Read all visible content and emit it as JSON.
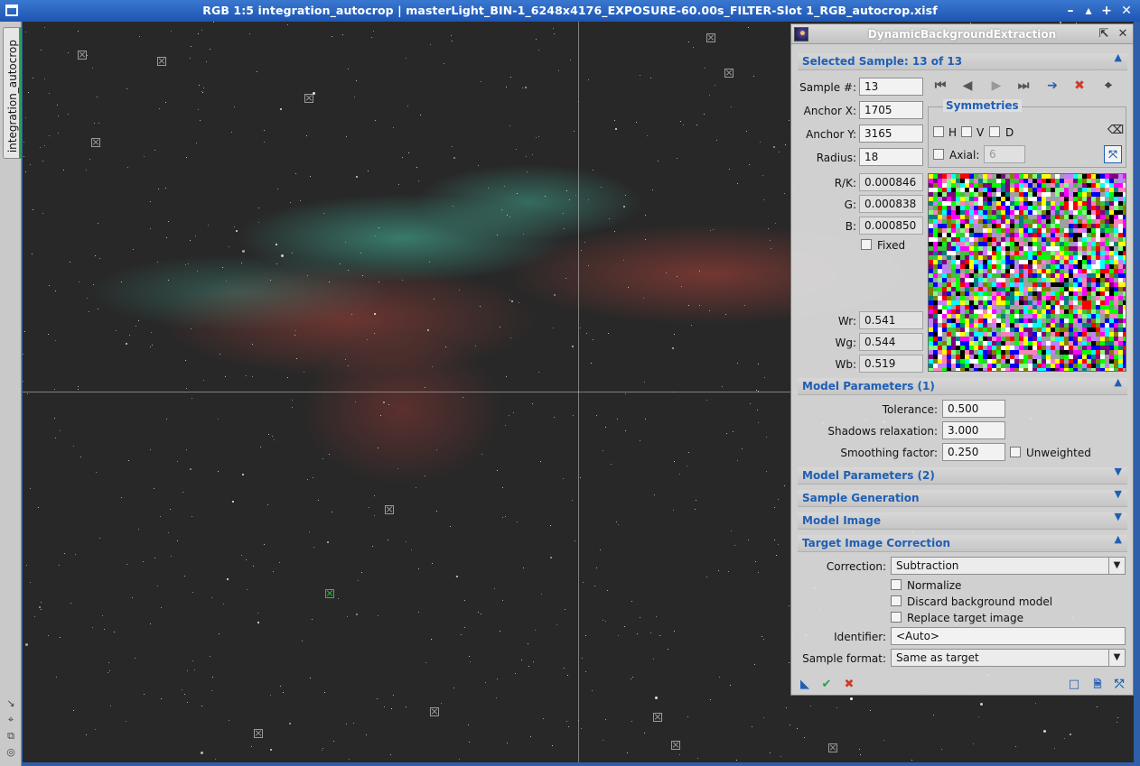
{
  "window": {
    "title": "RGB 1:5 integration_autocrop | masterLight_BIN-1_6248x4176_EXPOSURE-60.00s_FILTER-Slot 1_RGB_autocrop.xisf",
    "minimize_glyph": "–",
    "shade_glyph": "▴",
    "maximize_glyph": "+",
    "close_glyph": "✕"
  },
  "image_tab": {
    "label": "integration_autocrop"
  },
  "left_strip_icons": [
    "↘",
    "⌖",
    "⧉",
    "◎"
  ],
  "panel": {
    "title": "DynamicBackgroundExtraction",
    "collapse_glyph": "⇱",
    "close_glyph": "✕",
    "sections": {
      "selected_sample": "Selected Sample: 13 of 13",
      "model_params_1": "Model Parameters (1)",
      "model_params_2": "Model Parameters (2)",
      "sample_generation": "Sample Generation",
      "model_image": "Model Image",
      "target_correction": "Target Image Correction"
    },
    "expanded_arrow": "▲",
    "collapsed_arrow": "▼",
    "sample": {
      "number_label": "Sample #:",
      "number_value": "13",
      "anchor_x_label": "Anchor X:",
      "anchor_x_value": "1705",
      "anchor_y_label": "Anchor Y:",
      "anchor_y_value": "3165",
      "radius_label": "Radius:",
      "radius_value": "18",
      "rk_label": "R/K:",
      "rk_value": "0.000846",
      "g_label": "G:",
      "g_value": "0.000838",
      "b_label": "B:",
      "b_value": "0.000850",
      "fixed_label": "Fixed",
      "wr_label": "Wr:",
      "wr_value": "0.541",
      "wg_label": "Wg:",
      "wg_value": "0.544",
      "wb_label": "Wb:",
      "wb_value": "0.519"
    },
    "nav": {
      "first": "⏮",
      "prev": "◀",
      "next": "▶",
      "last": "⏭",
      "go": "➔",
      "delete": "✖",
      "target": "⌖"
    },
    "symmetries": {
      "title": "Symmetries",
      "h": "H",
      "v": "V",
      "d": "D",
      "axial_label": "Axial:",
      "axial_value": "6",
      "clear_glyph": "⌫",
      "tool_glyph": "⤧"
    },
    "model_params": {
      "tolerance_label": "Tolerance:",
      "tolerance_value": "0.500",
      "shadows_label": "Shadows relaxation:",
      "shadows_value": "3.000",
      "smoothing_label": "Smoothing factor:",
      "smoothing_value": "0.250",
      "unweighted_label": "Unweighted"
    },
    "correction": {
      "correction_label": "Correction:",
      "correction_value": "Subtraction",
      "normalize_label": "Normalize",
      "discard_label": "Discard background model",
      "replace_label": "Replace target image",
      "identifier_label": "Identifier:",
      "identifier_value": "<Auto>",
      "format_label": "Sample format:",
      "format_value": "Same as target"
    },
    "footer": {
      "new_instance": "◣",
      "execute": "✔",
      "cancel": "✖",
      "browse": "□",
      "doc": "🗎",
      "reset": "⤱"
    }
  },
  "colors": {
    "titlebar": "#1d55b3",
    "section_text": "#1f5fb5",
    "execute": "#2aa04a",
    "cancel": "#d03a2a",
    "selected_sample": "#29c23a"
  }
}
